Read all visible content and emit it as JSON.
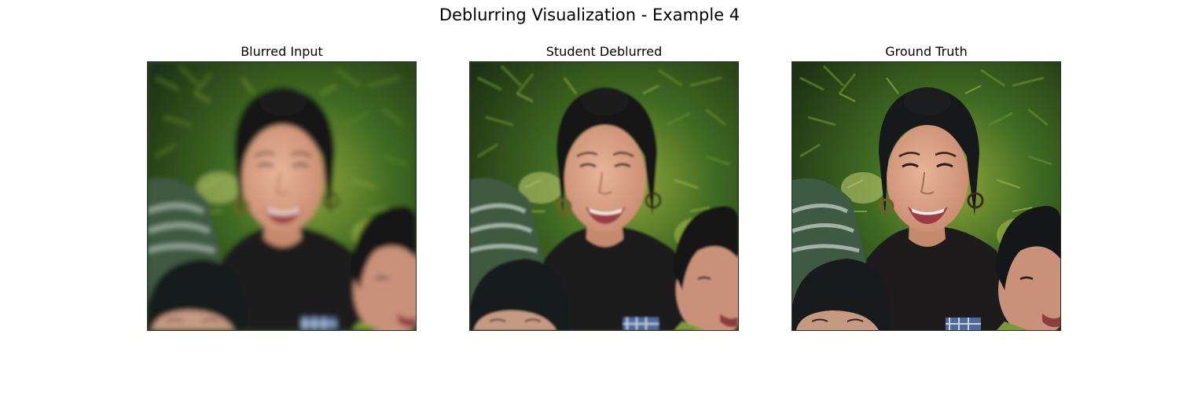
{
  "figure": {
    "title": "Deblurring Visualization - Example 4",
    "panels": [
      {
        "title": "Blurred Input",
        "blur": 3.2
      },
      {
        "title": "Student Deblurred",
        "blur": 1.4
      },
      {
        "title": "Ground Truth",
        "blur": 0
      }
    ]
  }
}
